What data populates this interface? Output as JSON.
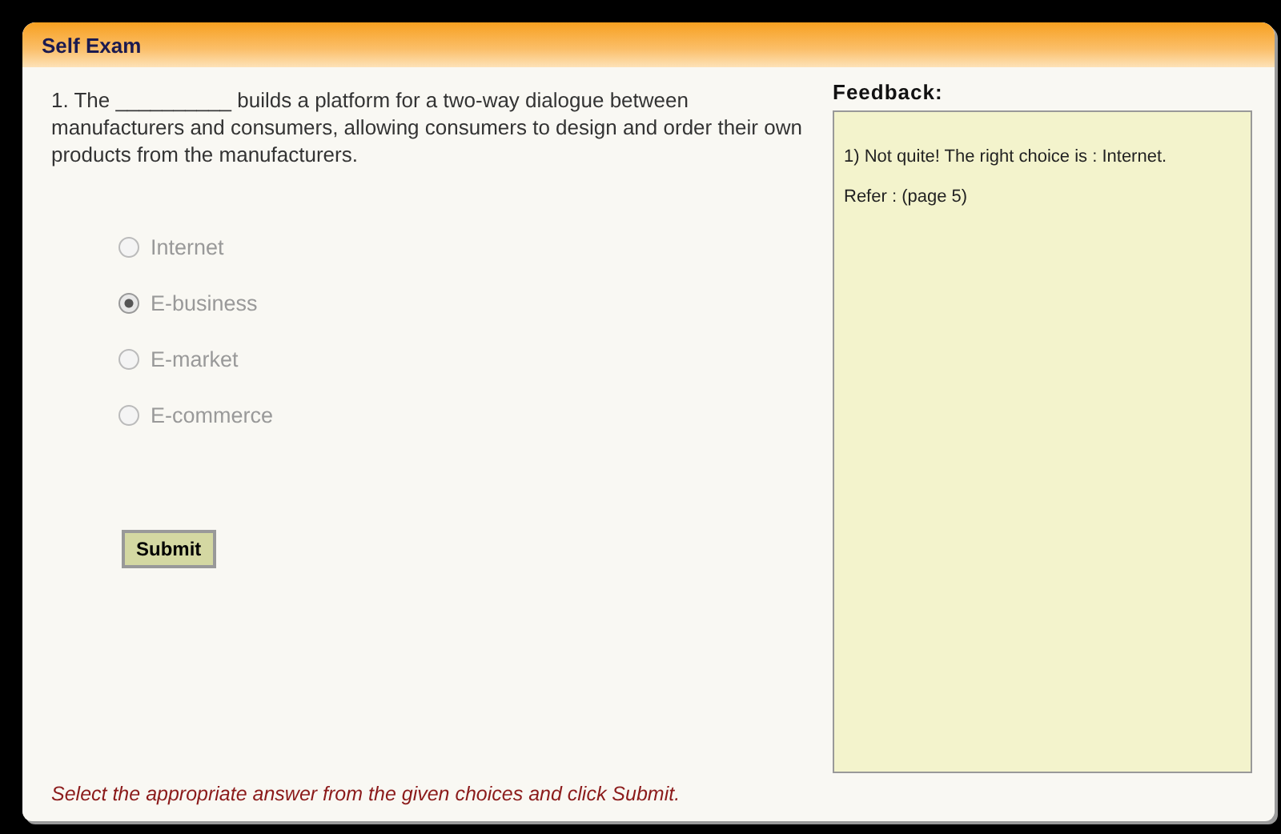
{
  "header": {
    "title": "Self Exam"
  },
  "question": {
    "text": "1. The __________ builds a platform for a two-way dialogue between manufacturers and consumers, allowing consumers to design and order their own products from the manufacturers."
  },
  "choices": [
    {
      "label": "Internet",
      "selected": false,
      "disabled": true
    },
    {
      "label": "E-business",
      "selected": true,
      "disabled": true
    },
    {
      "label": "E-market",
      "selected": false,
      "disabled": true
    },
    {
      "label": "E-commerce",
      "selected": false,
      "disabled": true
    }
  ],
  "submit": {
    "label": "Submit"
  },
  "feedback": {
    "heading": "Feedback:",
    "lines": [
      "1) Not quite! The right choice is : Internet.",
      "Refer : (page 5)"
    ]
  },
  "instruction": "Select the appropriate answer from the given choices and click Submit."
}
